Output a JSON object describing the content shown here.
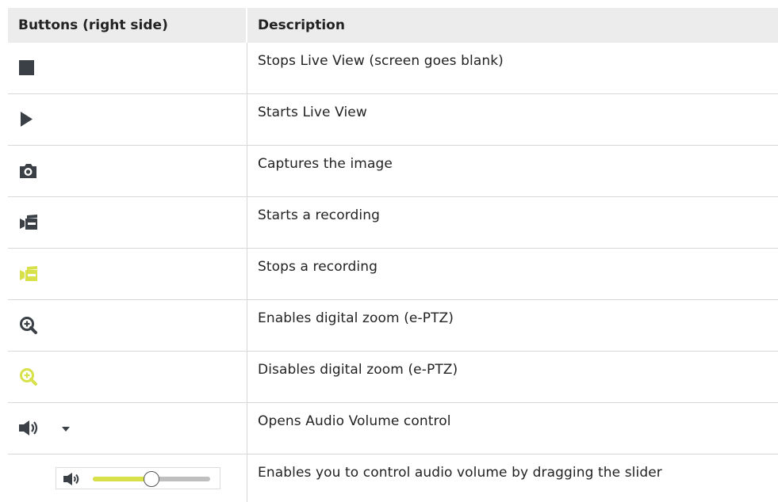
{
  "header": {
    "col1": "Buttons (right side)",
    "col2": "Description"
  },
  "rows": [
    {
      "icon": "stop-icon",
      "description": "Stops Live View (screen goes blank)"
    },
    {
      "icon": "play-icon",
      "description": "Starts Live View"
    },
    {
      "icon": "camera-icon",
      "description": "Captures the image"
    },
    {
      "icon": "video-record-icon",
      "description": "Starts a recording"
    },
    {
      "icon": "video-record-active-icon",
      "description": "Stops a recording"
    },
    {
      "icon": "zoom-in-icon",
      "description": "Enables digital zoom (e-PTZ)"
    },
    {
      "icon": "zoom-in-active-icon",
      "description": "Disables digital zoom (e-PTZ)"
    },
    {
      "icon": "speaker-dropdown-icon",
      "description": "Opens Audio Volume control"
    },
    {
      "icon": "volume-slider",
      "description": "Enables you to control audio volume by dragging the slider",
      "volume_level": 0.5
    }
  ],
  "colors": {
    "icon_dark": "#3a4045",
    "icon_active": "#d8e04a",
    "header_bg": "#ececec",
    "grid": "#d8d8d8"
  }
}
